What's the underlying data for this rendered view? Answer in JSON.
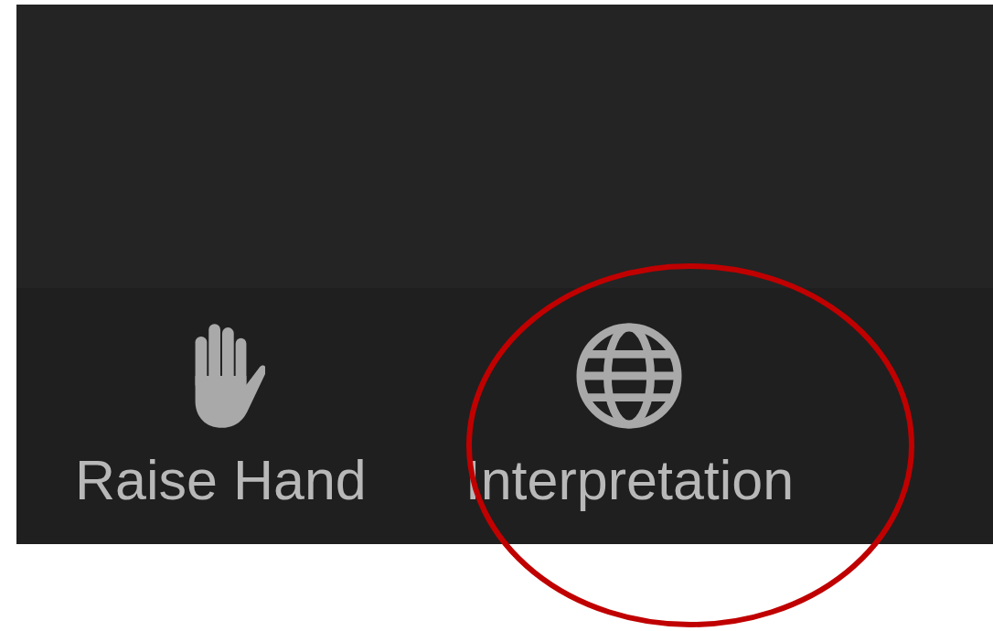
{
  "toolbar": {
    "buttons": [
      {
        "kind": "hand",
        "label": "Raise Hand"
      },
      {
        "kind": "globe",
        "label": "Interpretation"
      }
    ]
  },
  "annotation": {
    "kind": "ellipse",
    "color": "#c00000"
  }
}
